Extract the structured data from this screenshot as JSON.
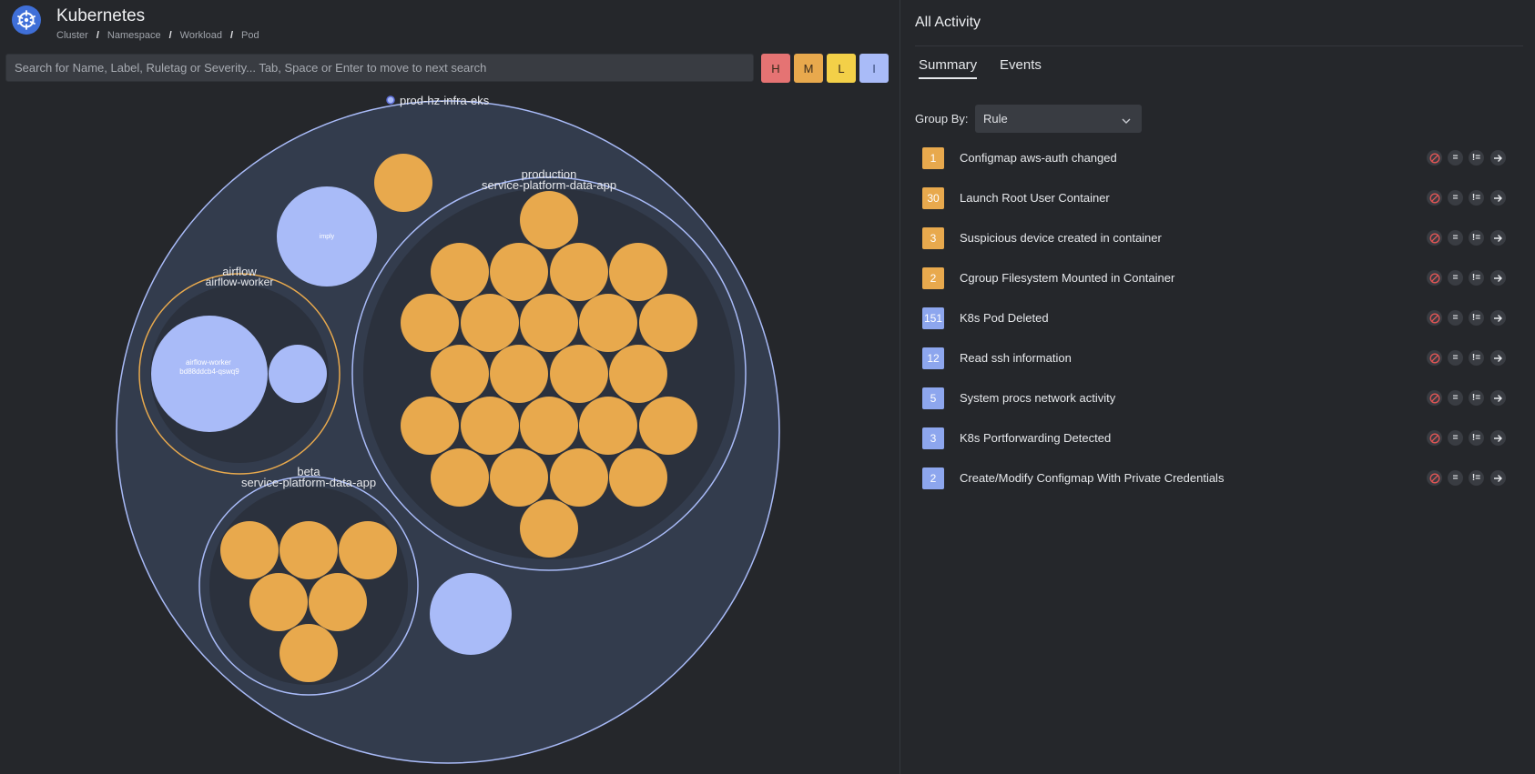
{
  "header": {
    "title": "Kubernetes",
    "breadcrumb": [
      "Cluster",
      "Namespace",
      "Workload",
      "Pod"
    ]
  },
  "search": {
    "placeholder": "Search for Name, Label, Ruletag or Severity... Tab, Space or Enter to move to next search"
  },
  "severity_filters": [
    {
      "label": "H",
      "color": "#e57373"
    },
    {
      "label": "M",
      "color": "#e8a94d"
    },
    {
      "label": "L",
      "color": "#f3d048"
    },
    {
      "label": "I",
      "color": "#a9bbf8"
    }
  ],
  "colors": {
    "cluster_ring": "#a9bbf8",
    "medium": "#e8a94d",
    "info": "#a9bbf8",
    "namespace_fill": "#333c4d",
    "workload_fill": "#2b313d"
  },
  "bubble_chart": {
    "cluster": "prod-hz-infra-eks",
    "namespaces": [
      {
        "name": "production",
        "workloads": [
          {
            "name": "service-platform-data-app",
            "pods": 26,
            "severity": "medium"
          }
        ]
      },
      {
        "name": "airflow",
        "workloads": [
          {
            "name": "airflow-worker",
            "pods": [
              "airflow-worker\nbd88ddcb4-qswq9",
              ""
            ],
            "severity": "medium"
          }
        ]
      },
      {
        "name": "beta",
        "workloads": [
          {
            "name": "service-platform-data-app",
            "pods": 6,
            "severity": "medium"
          }
        ]
      }
    ],
    "loose_pods": [
      {
        "label": "",
        "severity": "medium"
      },
      {
        "label": "imply",
        "severity": "info"
      },
      {
        "label": "",
        "severity": "info"
      }
    ]
  },
  "activity": {
    "title": "All Activity",
    "tabs": [
      "Summary",
      "Events"
    ],
    "active_tab": "Summary",
    "group_by_label": "Group By:",
    "group_by_value": "Rule",
    "rules": [
      {
        "count": "1",
        "name": "Configmap aws-auth changed",
        "severity": "medium"
      },
      {
        "count": "30",
        "name": "Launch Root User Container",
        "severity": "medium"
      },
      {
        "count": "3",
        "name": "Suspicious device created in container",
        "severity": "medium"
      },
      {
        "count": "2",
        "name": "Cgroup Filesystem Mounted in Container",
        "severity": "medium"
      },
      {
        "count": "151",
        "name": "K8s Pod Deleted",
        "severity": "info"
      },
      {
        "count": "12",
        "name": "Read ssh information",
        "severity": "info"
      },
      {
        "count": "5",
        "name": "System procs network activity",
        "severity": "info"
      },
      {
        "count": "3",
        "name": "K8s Portforwarding Detected",
        "severity": "info"
      },
      {
        "count": "2",
        "name": "Create/Modify Configmap With Private Credentials",
        "severity": "info"
      }
    ],
    "row_actions": {
      "equals": "=",
      "not_equals": "!="
    }
  }
}
